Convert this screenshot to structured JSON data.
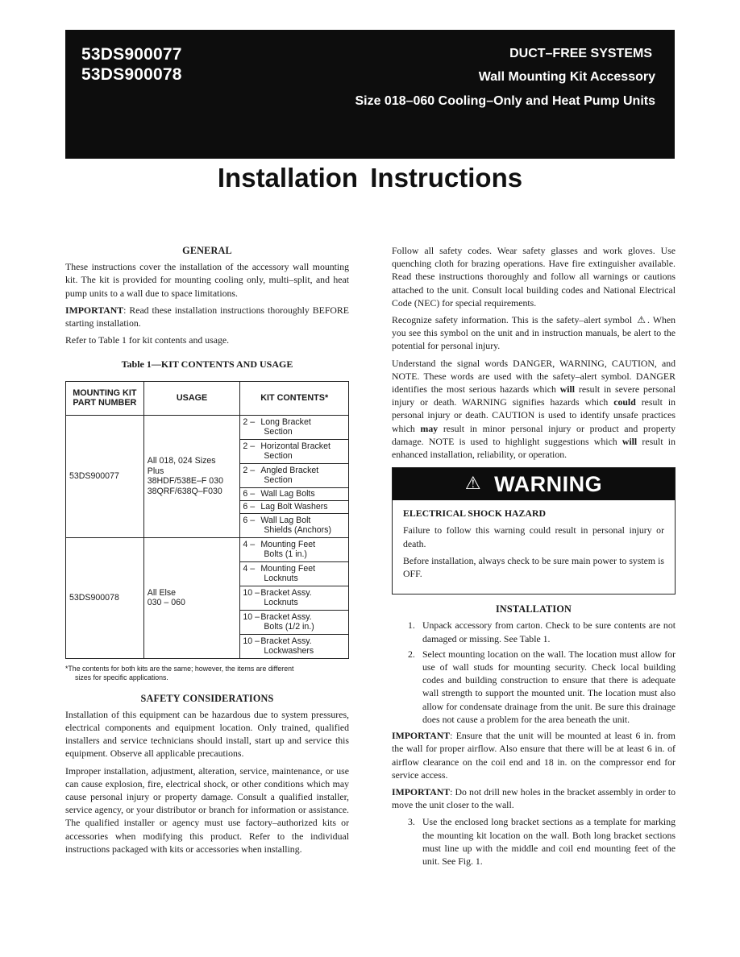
{
  "header": {
    "part_numbers": [
      "53DS900077",
      "53DS900078"
    ],
    "line1": "DUCT–FREE SYSTEMS",
    "line2": "Wall Mounting Kit Accessory",
    "line3": "Size 018–060 Cooling–Only and Heat Pump Units"
  },
  "title": "Installation Instructions",
  "general": {
    "heading": "GENERAL",
    "p1": "These instructions cover the installation of the accessory wall mounting kit. The kit is provided for mounting cooling only, multi–split, and heat pump units to a wall due to space limitations.",
    "p2_label": "IMPORTANT",
    "p2_text": ": Read these installation instructions thoroughly BEFORE starting installation.",
    "p3": "Refer to Table 1 for kit contents and usage."
  },
  "table1": {
    "caption": "Table 1—KIT CONTENTS AND USAGE",
    "headers": [
      "MOUNTING KIT PART NUMBER",
      "USAGE",
      "KIT CONTENTS*"
    ],
    "rows": [
      {
        "part": "53DS900077",
        "usage": [
          "All 018, 024 Sizes",
          "Plus",
          "38HDF/538E–F 030",
          "38QRF/638Q–F030"
        ],
        "items": [
          {
            "qty": "2 –",
            "name": "Long Bracket",
            "cont": "Section"
          },
          {
            "qty": "2 –",
            "name": "Horizontal Bracket",
            "cont": "Section"
          },
          {
            "qty": "2 –",
            "name": "Angled Bracket",
            "cont": "Section"
          },
          {
            "qty": "6 –",
            "name": "Wall Lag Bolts",
            "cont": ""
          },
          {
            "qty": "6 –",
            "name": "Lag Bolt Washers",
            "cont": ""
          },
          {
            "qty": "6 –",
            "name": "Wall Lag Bolt",
            "cont": "Shields (Anchors)"
          }
        ]
      },
      {
        "part": "53DS900078",
        "usage": [
          "All Else",
          "030 – 060"
        ],
        "items": [
          {
            "qty": "4 –",
            "name": "Mounting Feet",
            "cont": "Bolts (1 in.)"
          },
          {
            "qty": "4 –",
            "name": "Mounting Feet",
            "cont": "Locknuts"
          },
          {
            "qty": "10 –",
            "name": "Bracket Assy.",
            "cont": "Locknuts"
          },
          {
            "qty": "10 –",
            "name": "Bracket Assy.",
            "cont": "Bolts (1/2 in.)"
          },
          {
            "qty": "10 –",
            "name": "Bracket Assy.",
            "cont": "Lockwashers"
          }
        ]
      }
    ],
    "footnote1": "*The contents for both kits are the same; however, the items are different",
    "footnote2": "sizes for specific applications."
  },
  "safety": {
    "heading": "SAFETY CONSIDERATIONS",
    "p1": "Installation of this equipment can be hazardous due to system pressures, electrical components and equipment location. Only trained, qualified installers and service technicians should install, start up and service this equipment. Observe all applicable precautions.",
    "p2": "Improper installation, adjustment, alteration, service, maintenance, or use can cause explosion, fire, electrical shock, or other conditions which may cause personal injury or property damage. Consult a qualified installer, service agency, or your distributor or branch for information or assistance. The qualified installer or agency must use factory–authorized kits or accessories when modifying this product. Refer to the individual instructions packaged with kits or accessories when installing.",
    "p3": "Follow all safety codes. Wear safety glasses and work gloves. Use quenching cloth for brazing operations. Have fire extinguisher available. Read these instructions thoroughly and follow all warnings or cautions attached to the unit. Consult local building codes and National Electrical Code (NEC) for special requirements.",
    "p4a": "Recognize safety information. This is the safety–alert symbol",
    "p4b": ". When you see this symbol on the unit and in instruction manuals, be alert to the potential for personal injury.",
    "p5a": "Understand the signal words DANGER, WARNING, CAUTION, and NOTE. These words are used with the safety–alert symbol. DANGER identifies the most serious hazards which ",
    "p5_will1": "will",
    "p5b": " result in severe personal injury or death. WARNING signifies hazards which ",
    "p5_could": "could",
    "p5c": " result in personal injury or death. CAUTION is used to identify unsafe practices which ",
    "p5_may": "may",
    "p5d": " result in minor personal injury or product and property damage. NOTE is used to highlight suggestions which ",
    "p5_will2": "will",
    "p5e": " result in enhanced installation, reliability, or operation."
  },
  "warning": {
    "label": "WARNING",
    "title": "ELECTRICAL SHOCK HAZARD",
    "p1": "Failure to follow this warning could result in personal injury or death.",
    "p2": "Before installation, always check to be sure main power to system is OFF."
  },
  "installation": {
    "heading": "INSTALLATION",
    "steps": [
      {
        "num": "1.",
        "text": "Unpack accessory from carton. Check to be sure contents are not damaged or missing. See Table 1."
      },
      {
        "num": "2.",
        "text": "Select mounting location on the wall. The location must allow for use of wall studs for mounting security. Check local building codes and building construction to ensure that there is adequate wall strength to support the mounted unit. The location must also allow for condensate drainage from the unit. Be sure this drainage does not cause a problem for the area beneath the unit."
      }
    ],
    "imp1_label": "IMPORTANT",
    "imp1_text": ": Ensure that the unit will be mounted at least 6 in. from the wall for proper airflow. Also ensure that there will be at least 6 in. of airflow clearance on the coil end and 18 in. on the compressor end for service access.",
    "imp2_label": "IMPORTANT",
    "imp2_text": ": Do not drill new holes in the bracket assembly in order to move the unit closer to the wall.",
    "step3": {
      "num": "3.",
      "text": "Use the enclosed long bracket sections as a template for marking the mounting kit location on the wall. Both long bracket sections must line up with the middle and coil end mounting feet of the unit. See Fig. 1."
    }
  },
  "icons": {
    "safety_alert": "⚠",
    "warning": "⚠"
  }
}
